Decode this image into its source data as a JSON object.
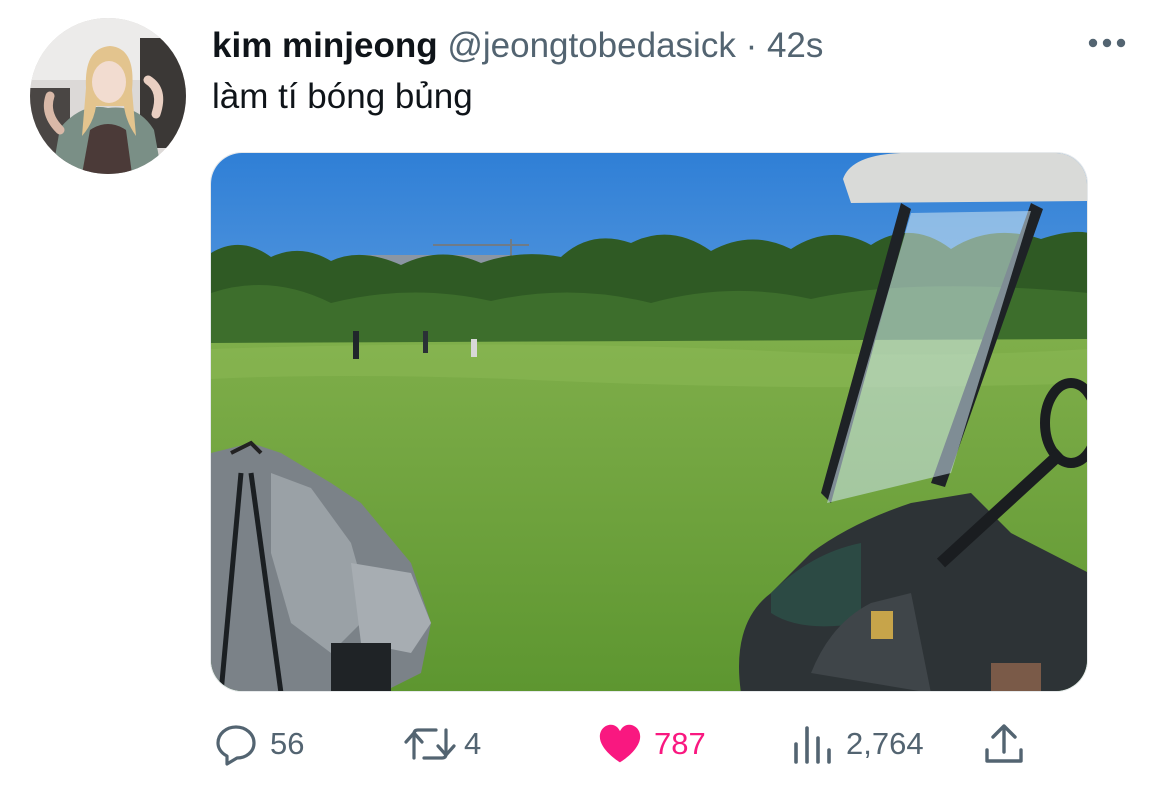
{
  "author": {
    "display_name": "kim minjeong",
    "handle": "@jeongtobedasick",
    "separator": "·",
    "time": "42s"
  },
  "tweet": {
    "text": "làm tí bóng bủng"
  },
  "actions": {
    "replies": "56",
    "retweets": "4",
    "likes": "787",
    "views": "2,764"
  },
  "icons": {
    "more": "more-horizontal-icon",
    "reply": "reply-bubble-icon",
    "retweet": "retweet-arrows-icon",
    "like": "heart-filled-icon",
    "views": "views-bars-icon",
    "share": "share-upload-icon"
  },
  "colors": {
    "text_primary": "#0f1419",
    "text_secondary": "#536471",
    "like_active": "#f91880"
  }
}
